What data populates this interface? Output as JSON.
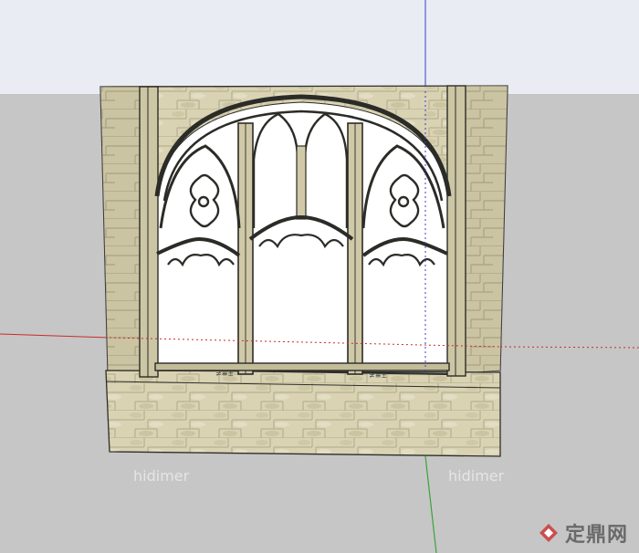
{
  "scene": {
    "sky_color": "#e9ecf3",
    "ground_color": "#c6c6c6",
    "stone_color": "#d8d2b2",
    "stone_dark": "#b9b291",
    "frame_color": "#3b3b35",
    "axis_red": "#cc2a2a",
    "axis_green": "#3aa33a",
    "axis_blue": "#3b3bcc"
  },
  "model": {
    "name": "gothic-window-wall"
  },
  "watermark": {
    "text_1": "hidimer",
    "text_2": "hidimer",
    "logo_text": "定鼎网",
    "logo_icon": "diamond-logo-icon"
  }
}
